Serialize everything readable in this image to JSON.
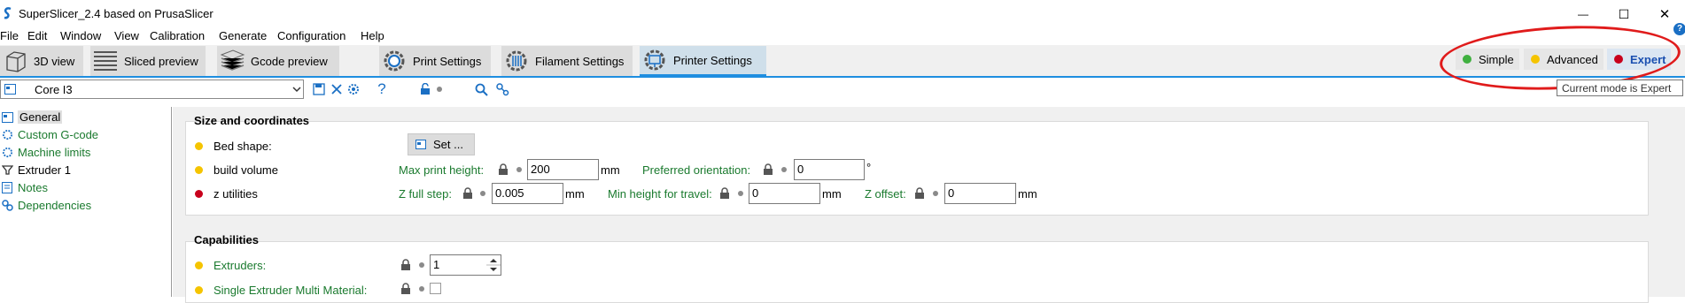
{
  "window": {
    "title": "SuperSlicer_2.4  based on PrusaSlicer",
    "minimize_glyph": "—",
    "maximize_glyph": "☐",
    "close_glyph": "✕"
  },
  "menu": [
    "File",
    "Edit",
    "Window",
    "View",
    "Calibration",
    "Generate",
    "Configuration",
    "Help"
  ],
  "tabs": [
    {
      "label": "3D view",
      "icon": "cube-icon"
    },
    {
      "label": "Sliced preview",
      "icon": "layers-icon"
    },
    {
      "label": "Gcode preview",
      "icon": "gcode-icon"
    },
    {
      "label": "Print Settings",
      "icon": "gear-icon"
    },
    {
      "label": "Filament Settings",
      "icon": "filament-gear-icon"
    },
    {
      "label": "Printer Settings",
      "icon": "printer-gear-icon",
      "active": true
    }
  ],
  "modes": [
    {
      "label": "Simple",
      "color": "#3fb03f"
    },
    {
      "label": "Advanced",
      "color": "#f5c400"
    },
    {
      "label": "Expert",
      "color": "#c8001c",
      "active": true
    }
  ],
  "tooltip": "Current mode is Expert",
  "help_glyph": "?",
  "preset": {
    "value": "Core I3"
  },
  "toolbar_help_glyph": "?",
  "sidebar": [
    {
      "label": "General",
      "selected": true,
      "green": false
    },
    {
      "label": "Custom G-code",
      "green": true
    },
    {
      "label": "Machine limits",
      "green": true
    },
    {
      "label": "Extruder 1",
      "green": false
    },
    {
      "label": "Notes",
      "green": true
    },
    {
      "label": "Dependencies",
      "green": true
    }
  ],
  "size_section": {
    "title": "Size and coordinates",
    "bed_shape": {
      "label": "Bed shape:",
      "button": "Set ..."
    },
    "build_volume": {
      "label": "build volume",
      "max_print_height": {
        "label": "Max print height:",
        "value": "200",
        "unit": "mm"
      },
      "preferred_orientation": {
        "label": "Preferred orientation:",
        "value": "0",
        "unit": "°"
      }
    },
    "z_utilities": {
      "label": "z utilities",
      "z_full_step": {
        "label": "Z full step:",
        "value": "0.005",
        "unit": "mm"
      },
      "min_height_travel": {
        "label": "Min height for travel:",
        "value": "0",
        "unit": "mm"
      },
      "z_offset": {
        "label": "Z offset:",
        "value": "0",
        "unit": "mm"
      }
    }
  },
  "capabilities_section": {
    "title": "Capabilities",
    "extruders": {
      "label": "Extruders:",
      "value": "1"
    },
    "single_extruder_mm": {
      "label": "Single Extruder Multi Material:",
      "checked": false
    }
  }
}
